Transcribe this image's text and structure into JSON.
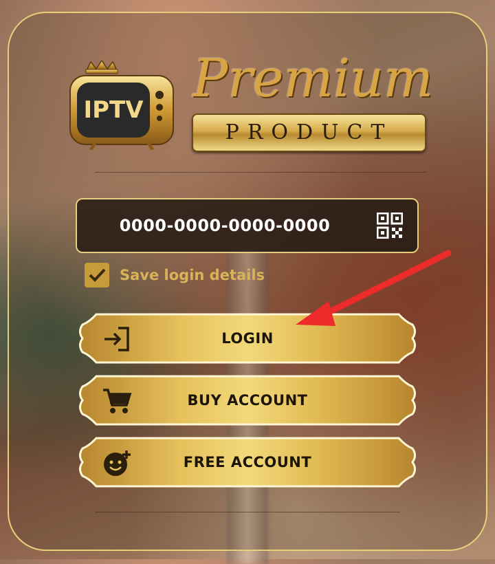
{
  "logo": {
    "tv_text": "IPTV",
    "script_text": "Premium",
    "plaque_text": "PRODUCT"
  },
  "login": {
    "code_value": "0000-0000-0000-0000",
    "qr_icon": "qr-code-icon",
    "save_checked": true,
    "save_label": "Save login details"
  },
  "buttons": [
    {
      "label": "LOGIN",
      "icon": "login-icon"
    },
    {
      "label": "BUY ACCOUNT",
      "icon": "cart-icon"
    },
    {
      "label": "FREE ACCOUNT",
      "icon": "add-user-icon"
    }
  ],
  "colors": {
    "gold": "#e8cf7a",
    "button_dark_text": "#1d1508",
    "checkbox": "#c79a3a",
    "arrow": "#ee2b2b"
  }
}
